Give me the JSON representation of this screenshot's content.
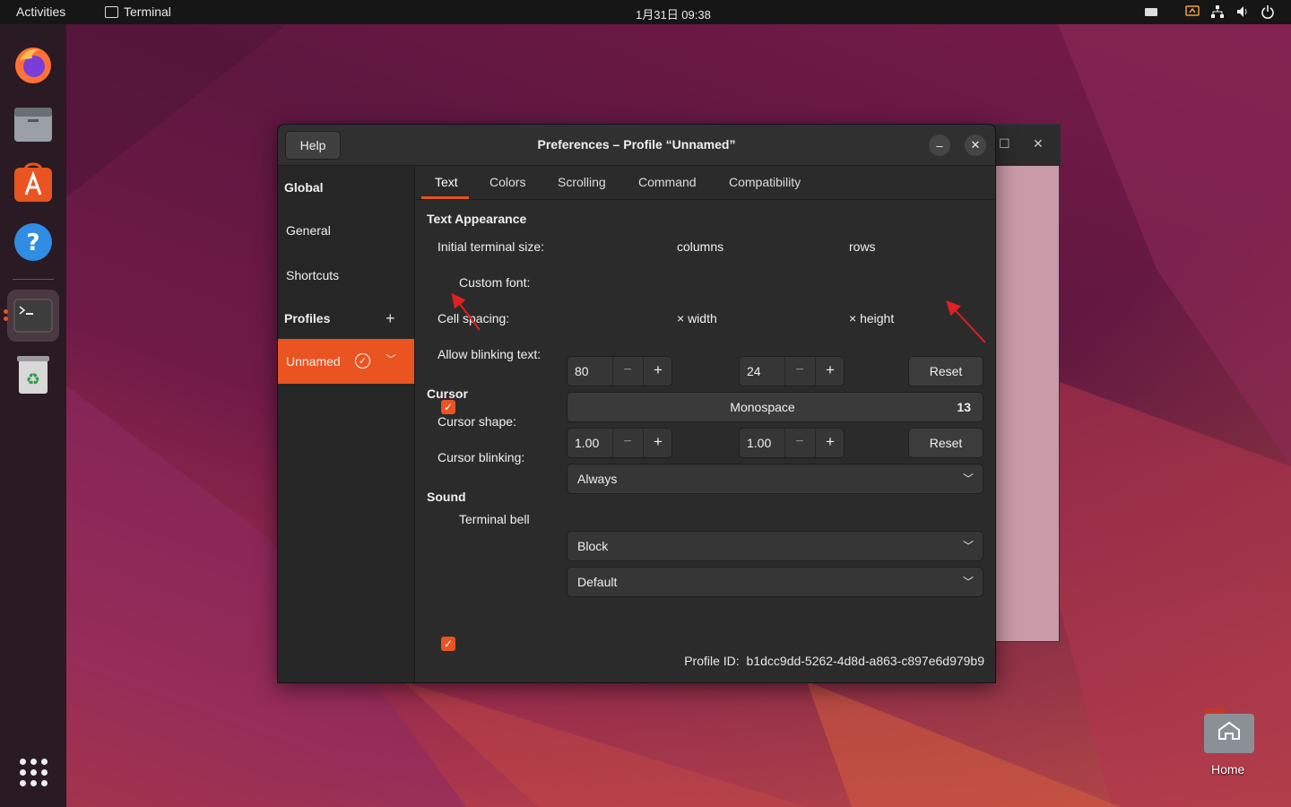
{
  "topbar": {
    "activities": "Activities",
    "app_name": "Terminal",
    "clock": "1月31日  09:38"
  },
  "dock": {
    "items": [
      "firefox-icon",
      "files-icon",
      "app-center-icon",
      "help-icon",
      "terminal-icon",
      "trash-icon",
      "show-apps-icon"
    ]
  },
  "dialog": {
    "help": "Help",
    "title": "Preferences – Profile “Unnamed”",
    "minimize": "–",
    "close": "✕"
  },
  "sidebar": {
    "global": "Global",
    "general": "General",
    "shortcuts": "Shortcuts",
    "profiles": "Profiles",
    "add_profile": "+",
    "selected_profile": "Unnamed"
  },
  "tabs": [
    "Text",
    "Colors",
    "Scrolling",
    "Command",
    "Compatibility"
  ],
  "text_appearance": {
    "heading": "Text Appearance",
    "size_label": "Initial terminal size:",
    "columns_value": "80",
    "columns_unit": "columns",
    "rows_value": "24",
    "rows_unit": "rows",
    "reset": "Reset",
    "custom_font_label": "Custom font:",
    "custom_font_checked": true,
    "font_name": "Monospace",
    "font_size": "13",
    "cell_spacing_label": "Cell spacing:",
    "width_value": "1.00",
    "width_unit": "× width",
    "height_value": "1.00",
    "height_unit": "× height",
    "reset2": "Reset",
    "blink_label": "Allow blinking text:",
    "blink_value": "Always"
  },
  "cursor": {
    "heading": "Cursor",
    "shape_label": "Cursor shape:",
    "shape_value": "Block",
    "blinking_label": "Cursor blinking:",
    "blinking_value": "Default"
  },
  "sound": {
    "heading": "Sound",
    "bell_label": "Terminal bell",
    "bell_checked": true
  },
  "profile_id": {
    "label": "Profile ID:",
    "value": "b1dcc9dd-5262-4d8d-a863-c897e6d979b9"
  },
  "desktop": {
    "home_label": "Home"
  },
  "colors": {
    "accent": "#e95420",
    "dialog_bg": "#2b2b2b",
    "annotation_arrow": "#e02020"
  }
}
